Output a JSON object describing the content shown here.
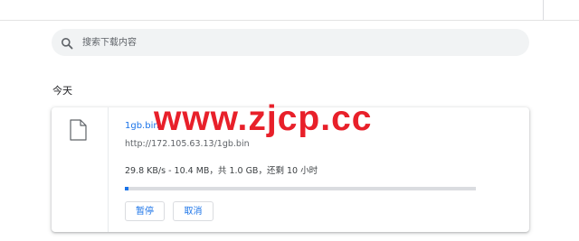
{
  "search": {
    "placeholder": "搜索下载内容",
    "value": "",
    "icon": "search-icon"
  },
  "section": {
    "title": "今天"
  },
  "download": {
    "file_name": "1gb.bin",
    "url": "http://172.105.63.13/1gb.bin",
    "status": "29.8 KB/s - 10.4 MB，共 1.0 GB，还剩 10 小时",
    "progress_fraction": 0.0101,
    "icon": "file-icon",
    "buttons": {
      "pause": "暂停",
      "cancel": "取消"
    }
  },
  "watermark": {
    "text": "www.zjcp.cc"
  },
  "colors": {
    "accent": "#1a73e8",
    "watermark": "#e8202a",
    "search_bg": "#f1f3f4",
    "progress_track": "#dadce0"
  }
}
